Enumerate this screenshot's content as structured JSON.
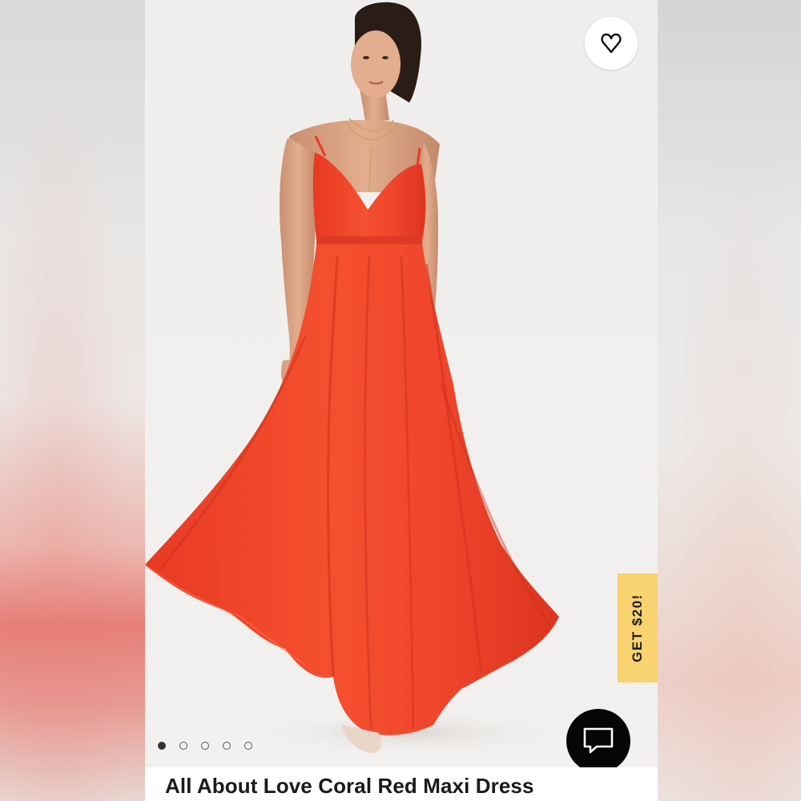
{
  "product": {
    "title": "All About Love Coral Red Maxi Dress",
    "dress_color": "#f2452d"
  },
  "favorite": {
    "icon": "heart-icon"
  },
  "promo": {
    "label": "GET $20!",
    "color": "#f9d36f"
  },
  "chat": {
    "icon": "chat-bubble-icon"
  },
  "carousel": {
    "total_slides": 5,
    "active_index": 0
  },
  "colors": {
    "background": "#efeeed",
    "chat_button": "#060606"
  }
}
